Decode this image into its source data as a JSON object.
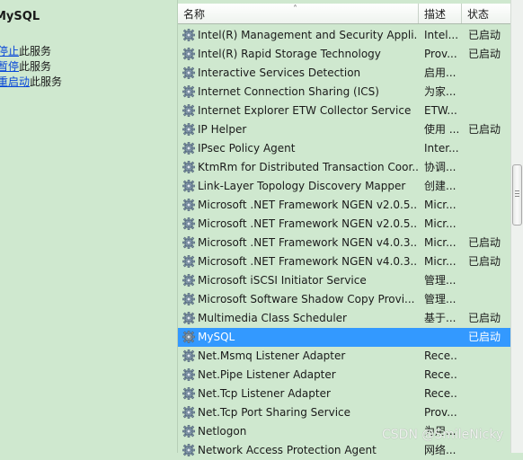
{
  "left": {
    "service_title": "MySQL",
    "actions": [
      {
        "link": "停止",
        "suffix": "此服务"
      },
      {
        "link": "暂停",
        "suffix": "此服务"
      },
      {
        "link": "重启动",
        "suffix": "此服务"
      }
    ]
  },
  "table": {
    "columns": {
      "name": "名称",
      "desc": "描述",
      "status": "状态"
    },
    "sort_indicator": "˄",
    "rows": [
      {
        "name": "Intel(R) Management and Security Appli...",
        "desc": "Intel...",
        "status": "已启动"
      },
      {
        "name": "Intel(R) Rapid Storage Technology",
        "desc": "Prov...",
        "status": "已启动"
      },
      {
        "name": "Interactive Services Detection",
        "desc": "启用...",
        "status": ""
      },
      {
        "name": "Internet Connection Sharing (ICS)",
        "desc": "为家...",
        "status": ""
      },
      {
        "name": "Internet Explorer ETW Collector Service",
        "desc": "ETW...",
        "status": ""
      },
      {
        "name": "IP Helper",
        "desc": "使用 ...",
        "status": "已启动"
      },
      {
        "name": "IPsec Policy Agent",
        "desc": "Inter...",
        "status": ""
      },
      {
        "name": "KtmRm for Distributed Transaction Coor...",
        "desc": "协调...",
        "status": ""
      },
      {
        "name": "Link-Layer Topology Discovery Mapper",
        "desc": "创建...",
        "status": ""
      },
      {
        "name": "Microsoft .NET Framework NGEN v2.0.5...",
        "desc": "Micr...",
        "status": ""
      },
      {
        "name": "Microsoft .NET Framework NGEN v2.0.5...",
        "desc": "Micr...",
        "status": ""
      },
      {
        "name": "Microsoft .NET Framework NGEN v4.0.3...",
        "desc": "Micr...",
        "status": "已启动"
      },
      {
        "name": "Microsoft .NET Framework NGEN v4.0.3...",
        "desc": "Micr...",
        "status": "已启动"
      },
      {
        "name": "Microsoft iSCSI Initiator Service",
        "desc": "管理...",
        "status": ""
      },
      {
        "name": "Microsoft Software Shadow Copy Provi...",
        "desc": "管理...",
        "status": ""
      },
      {
        "name": "Multimedia Class Scheduler",
        "desc": "基于...",
        "status": "已启动"
      },
      {
        "name": "MySQL",
        "desc": "",
        "status": "已启动"
      },
      {
        "name": "Net.Msmq Listener Adapter",
        "desc": "Rece...",
        "status": ""
      },
      {
        "name": "Net.Pipe Listener Adapter",
        "desc": "Rece...",
        "status": ""
      },
      {
        "name": "Net.Tcp Listener Adapter",
        "desc": "Rece...",
        "status": ""
      },
      {
        "name": "Net.Tcp Port Sharing Service",
        "desc": "Prov...",
        "status": ""
      },
      {
        "name": "Netlogon",
        "desc": "为用...",
        "status": ""
      },
      {
        "name": "Network Access Protection Agent",
        "desc": "网络...",
        "status": ""
      }
    ],
    "selected_row": 16
  },
  "watermark": "CSDN @SmileNicky",
  "colors": {
    "background": "#cfe8cf",
    "selection": "#3399ff",
    "link": "#0645d8"
  },
  "icons": {
    "row_icon": "gear-icon"
  }
}
